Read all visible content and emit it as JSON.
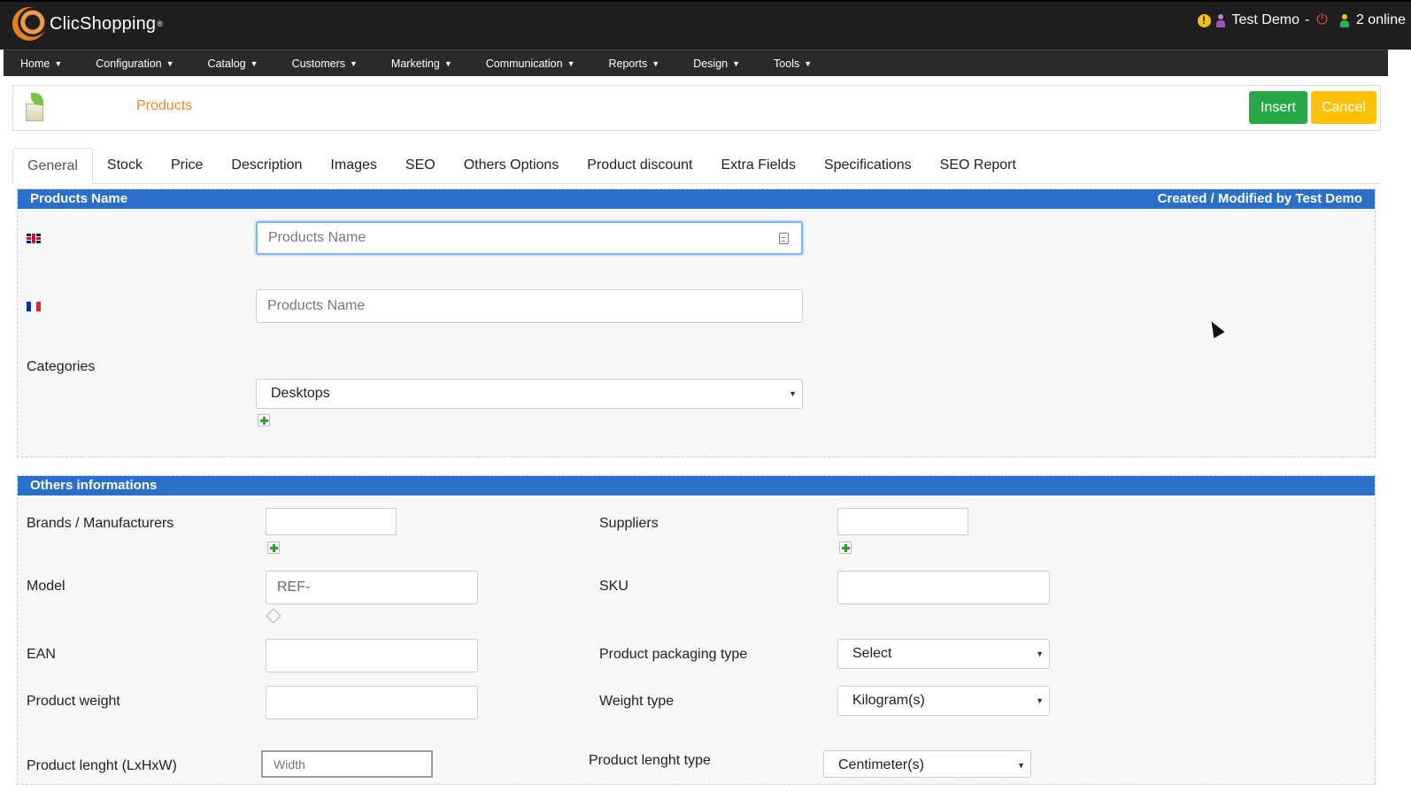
{
  "header": {
    "logo_text": "ClicShopping",
    "logo_reg": "®",
    "user_name": "Test Demo",
    "separator": "-",
    "online_count": "2 online"
  },
  "menu": [
    {
      "label": "Home"
    },
    {
      "label": "Configuration"
    },
    {
      "label": "Catalog"
    },
    {
      "label": "Customers"
    },
    {
      "label": "Marketing"
    },
    {
      "label": "Communication"
    },
    {
      "label": "Reports"
    },
    {
      "label": "Design"
    },
    {
      "label": "Tools"
    }
  ],
  "page": {
    "title": "Products",
    "insert_label": "Insert",
    "cancel_label": "Cancel"
  },
  "tabs": [
    {
      "label": "General",
      "active": true
    },
    {
      "label": "Stock"
    },
    {
      "label": "Price"
    },
    {
      "label": "Description"
    },
    {
      "label": "Images"
    },
    {
      "label": "SEO"
    },
    {
      "label": "Others Options"
    },
    {
      "label": "Product discount"
    },
    {
      "label": "Extra Fields"
    },
    {
      "label": "Specifications"
    },
    {
      "label": "SEO Report"
    }
  ],
  "products_name": {
    "heading": "Products Name",
    "created_by": "Created / Modified by Test Demo",
    "name_en_placeholder": "Products Name",
    "name_fr_placeholder": "Products Name",
    "categories_label": "Categories",
    "categories_value": "Desktops"
  },
  "others": {
    "heading": "Others informations",
    "brands_label": "Brands / Manufacturers",
    "suppliers_label": "Suppliers",
    "model_label": "Model",
    "model_value": "REF-",
    "sku_label": "SKU",
    "ean_label": "EAN",
    "packaging_label": "Product packaging type",
    "packaging_value": "Select",
    "weight_label": "Product weight",
    "weight_type_label": "Weight type",
    "weight_type_value": "Kilogram(s)",
    "length_label": "Product lenght (LxHxW)",
    "length_placeholder": "Width",
    "length_type_label": "Product lenght type",
    "length_type_value": "Centimeter(s)"
  },
  "colors": {
    "section_blue": "#2a6fc9",
    "insert_green": "#28a745",
    "cancel_yellow": "#ffc107",
    "title_orange": "#f0852d"
  }
}
